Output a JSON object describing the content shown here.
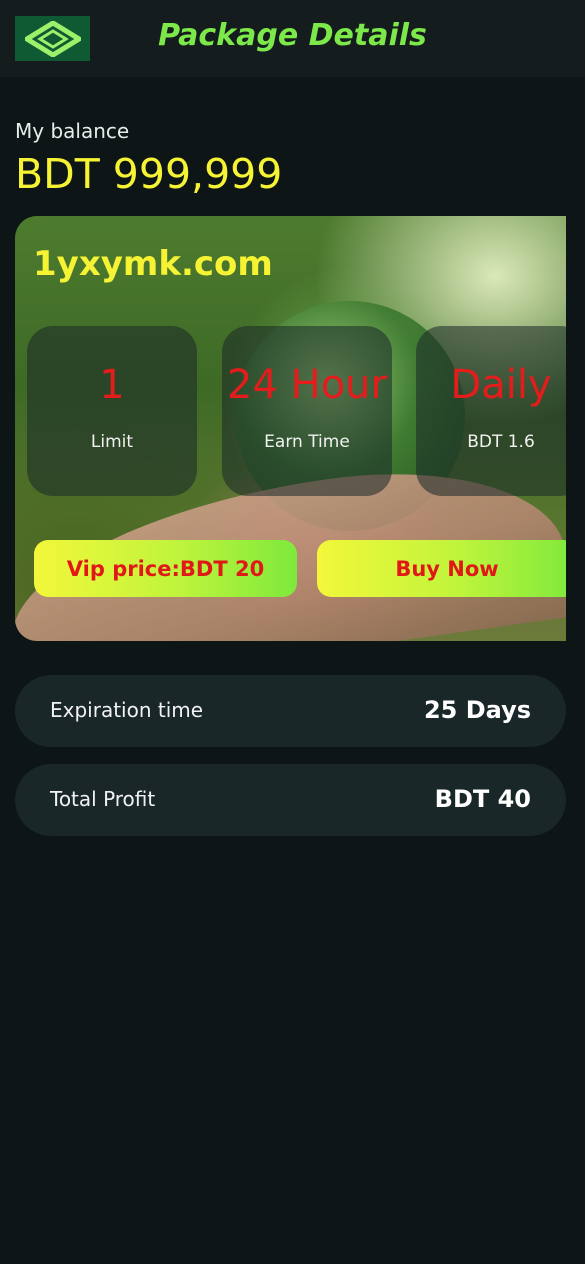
{
  "header": {
    "title": "Package Details",
    "logo_icon": "diamond-chevron-logo-icon",
    "colors": {
      "title": "#7de84a",
      "logo_bg": "#0f5a32"
    }
  },
  "balance": {
    "label": "My balance",
    "value": "BDT 999,999"
  },
  "card": {
    "site": "1yxymk.com",
    "stats": [
      {
        "value": "1",
        "label": "Limit"
      },
      {
        "value": "24 Hour",
        "label": "Earn Time"
      },
      {
        "value": "Daily",
        "label": "BDT 1.6"
      }
    ],
    "vip_price_label": "Vip price:BDT 20",
    "buy_label": "Buy Now"
  },
  "details": {
    "expiration": {
      "label": "Expiration time",
      "value": "25 Days"
    },
    "profit": {
      "label": "Total Profit",
      "value": "BDT 40"
    }
  },
  "colors": {
    "accent_yellow": "#f6f234",
    "stat_value_red": "#e51c1c",
    "background": "#0d1516",
    "row_bg": "#192729"
  }
}
